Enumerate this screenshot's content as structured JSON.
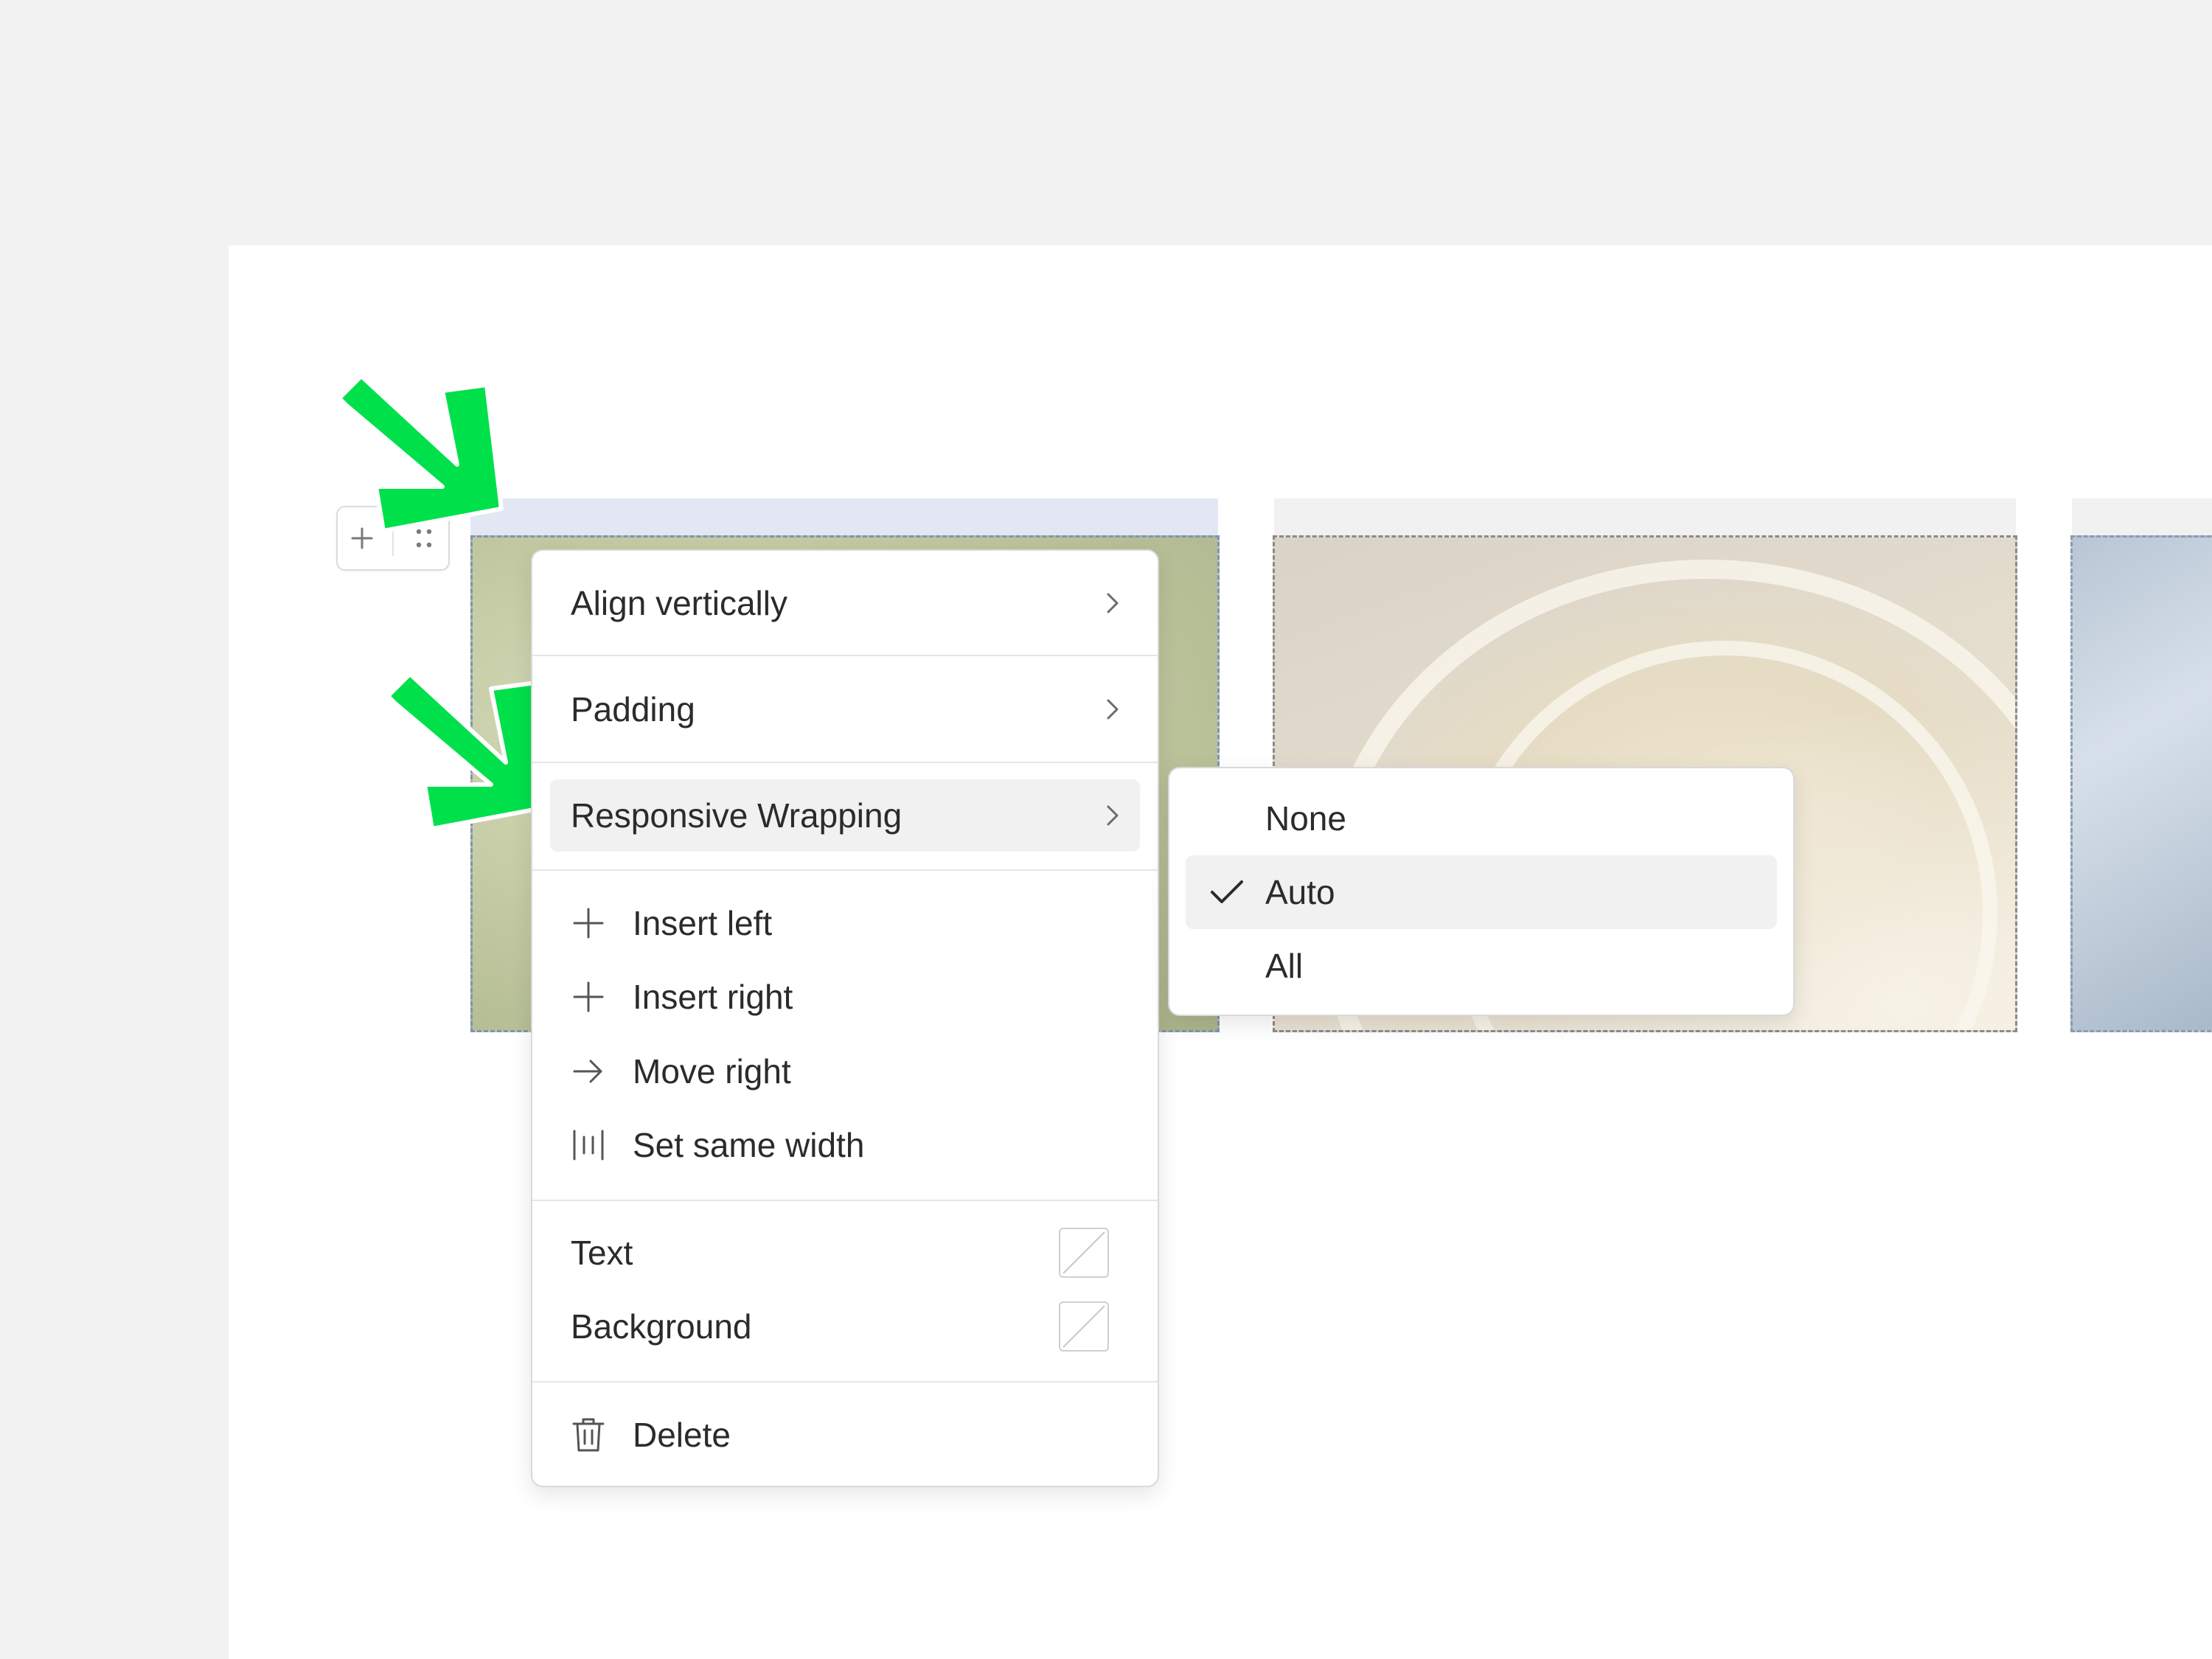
{
  "context_menu": {
    "align_vertically": "Align vertically",
    "padding": "Padding",
    "responsive_wrapping": "Responsive Wrapping",
    "insert_left": "Insert left",
    "insert_right": "Insert right",
    "move_right": "Move right",
    "set_same_width": "Set same width",
    "text": "Text",
    "background": "Background",
    "delete": "Delete"
  },
  "wrapping_submenu": {
    "options": [
      "None",
      "Auto",
      "All"
    ],
    "selected": "Auto"
  },
  "icons": {
    "submenu_arrow": "chevron-right-icon",
    "insert": "plus-icon",
    "move": "arrow-right-icon",
    "same_width": "columns-equal-icon",
    "delete": "trash-icon",
    "selected": "check-icon",
    "handle_add": "plus-icon",
    "handle_drag": "drag-dots-icon"
  },
  "colors": {
    "annotation_arrow": "#00e04b",
    "selection_strip": "#e3e7f3",
    "menu_highlight": "#f1f1f1"
  }
}
